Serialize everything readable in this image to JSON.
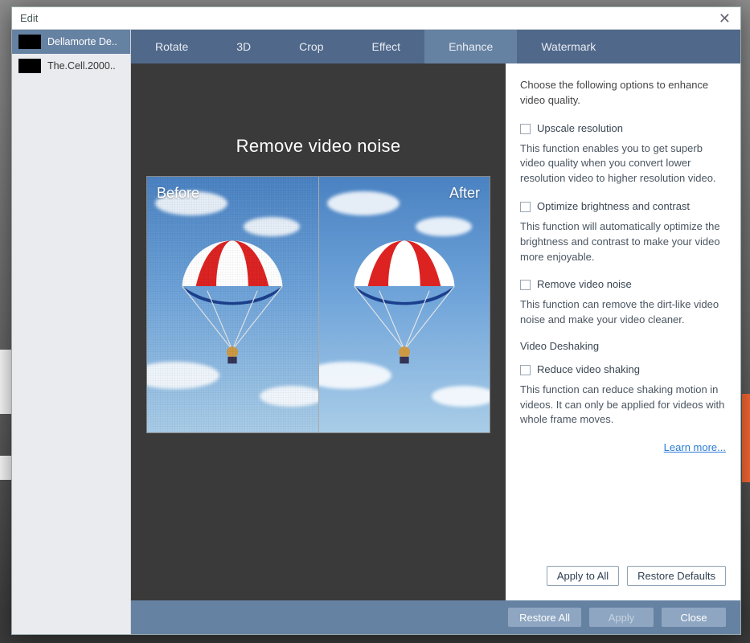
{
  "window": {
    "title": "Edit"
  },
  "sidebar": {
    "items": [
      {
        "label": "Dellamorte De.."
      },
      {
        "label": "The.Cell.2000.."
      }
    ]
  },
  "tabs": [
    {
      "label": "Rotate"
    },
    {
      "label": "3D"
    },
    {
      "label": "Crop"
    },
    {
      "label": "Effect"
    },
    {
      "label": "Enhance"
    },
    {
      "label": "Watermark"
    }
  ],
  "preview": {
    "title": "Remove video noise",
    "before_label": "Before",
    "after_label": "After"
  },
  "panel": {
    "intro": "Choose the following options to enhance video quality.",
    "options": [
      {
        "label": "Upscale resolution",
        "desc": "This function enables you to get superb video quality when you convert lower resolution video to higher resolution video."
      },
      {
        "label": "Optimize brightness and contrast",
        "desc": "This function will automatically optimize the brightness and contrast to make your video more enjoyable."
      },
      {
        "label": "Remove video noise",
        "desc": "This function can remove the dirt-like video noise and make your video cleaner."
      }
    ],
    "section_heading": "Video Deshaking",
    "deshake": {
      "label": "Reduce video shaking",
      "desc": "This function can reduce shaking motion in videos. It can only be applied for videos with whole frame moves."
    },
    "learn_more": "Learn more...",
    "apply_all": "Apply to All",
    "restore_defaults": "Restore Defaults"
  },
  "footer": {
    "restore_all": "Restore All",
    "apply": "Apply",
    "close": "Close"
  }
}
